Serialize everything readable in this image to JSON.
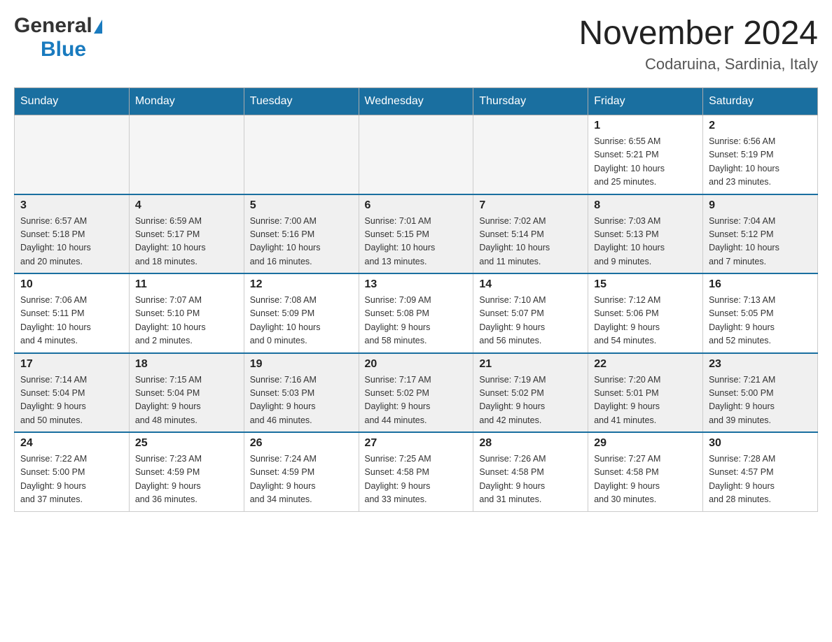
{
  "logo": {
    "text1": "General",
    "text2": "Blue"
  },
  "title": "November 2024",
  "location": "Codaruina, Sardinia, Italy",
  "days_of_week": [
    "Sunday",
    "Monday",
    "Tuesday",
    "Wednesday",
    "Thursday",
    "Friday",
    "Saturday"
  ],
  "weeks": [
    [
      {
        "day": "",
        "info": ""
      },
      {
        "day": "",
        "info": ""
      },
      {
        "day": "",
        "info": ""
      },
      {
        "day": "",
        "info": ""
      },
      {
        "day": "",
        "info": ""
      },
      {
        "day": "1",
        "info": "Sunrise: 6:55 AM\nSunset: 5:21 PM\nDaylight: 10 hours\nand 25 minutes."
      },
      {
        "day": "2",
        "info": "Sunrise: 6:56 AM\nSunset: 5:19 PM\nDaylight: 10 hours\nand 23 minutes."
      }
    ],
    [
      {
        "day": "3",
        "info": "Sunrise: 6:57 AM\nSunset: 5:18 PM\nDaylight: 10 hours\nand 20 minutes."
      },
      {
        "day": "4",
        "info": "Sunrise: 6:59 AM\nSunset: 5:17 PM\nDaylight: 10 hours\nand 18 minutes."
      },
      {
        "day": "5",
        "info": "Sunrise: 7:00 AM\nSunset: 5:16 PM\nDaylight: 10 hours\nand 16 minutes."
      },
      {
        "day": "6",
        "info": "Sunrise: 7:01 AM\nSunset: 5:15 PM\nDaylight: 10 hours\nand 13 minutes."
      },
      {
        "day": "7",
        "info": "Sunrise: 7:02 AM\nSunset: 5:14 PM\nDaylight: 10 hours\nand 11 minutes."
      },
      {
        "day": "8",
        "info": "Sunrise: 7:03 AM\nSunset: 5:13 PM\nDaylight: 10 hours\nand 9 minutes."
      },
      {
        "day": "9",
        "info": "Sunrise: 7:04 AM\nSunset: 5:12 PM\nDaylight: 10 hours\nand 7 minutes."
      }
    ],
    [
      {
        "day": "10",
        "info": "Sunrise: 7:06 AM\nSunset: 5:11 PM\nDaylight: 10 hours\nand 4 minutes."
      },
      {
        "day": "11",
        "info": "Sunrise: 7:07 AM\nSunset: 5:10 PM\nDaylight: 10 hours\nand 2 minutes."
      },
      {
        "day": "12",
        "info": "Sunrise: 7:08 AM\nSunset: 5:09 PM\nDaylight: 10 hours\nand 0 minutes."
      },
      {
        "day": "13",
        "info": "Sunrise: 7:09 AM\nSunset: 5:08 PM\nDaylight: 9 hours\nand 58 minutes."
      },
      {
        "day": "14",
        "info": "Sunrise: 7:10 AM\nSunset: 5:07 PM\nDaylight: 9 hours\nand 56 minutes."
      },
      {
        "day": "15",
        "info": "Sunrise: 7:12 AM\nSunset: 5:06 PM\nDaylight: 9 hours\nand 54 minutes."
      },
      {
        "day": "16",
        "info": "Sunrise: 7:13 AM\nSunset: 5:05 PM\nDaylight: 9 hours\nand 52 minutes."
      }
    ],
    [
      {
        "day": "17",
        "info": "Sunrise: 7:14 AM\nSunset: 5:04 PM\nDaylight: 9 hours\nand 50 minutes."
      },
      {
        "day": "18",
        "info": "Sunrise: 7:15 AM\nSunset: 5:04 PM\nDaylight: 9 hours\nand 48 minutes."
      },
      {
        "day": "19",
        "info": "Sunrise: 7:16 AM\nSunset: 5:03 PM\nDaylight: 9 hours\nand 46 minutes."
      },
      {
        "day": "20",
        "info": "Sunrise: 7:17 AM\nSunset: 5:02 PM\nDaylight: 9 hours\nand 44 minutes."
      },
      {
        "day": "21",
        "info": "Sunrise: 7:19 AM\nSunset: 5:02 PM\nDaylight: 9 hours\nand 42 minutes."
      },
      {
        "day": "22",
        "info": "Sunrise: 7:20 AM\nSunset: 5:01 PM\nDaylight: 9 hours\nand 41 minutes."
      },
      {
        "day": "23",
        "info": "Sunrise: 7:21 AM\nSunset: 5:00 PM\nDaylight: 9 hours\nand 39 minutes."
      }
    ],
    [
      {
        "day": "24",
        "info": "Sunrise: 7:22 AM\nSunset: 5:00 PM\nDaylight: 9 hours\nand 37 minutes."
      },
      {
        "day": "25",
        "info": "Sunrise: 7:23 AM\nSunset: 4:59 PM\nDaylight: 9 hours\nand 36 minutes."
      },
      {
        "day": "26",
        "info": "Sunrise: 7:24 AM\nSunset: 4:59 PM\nDaylight: 9 hours\nand 34 minutes."
      },
      {
        "day": "27",
        "info": "Sunrise: 7:25 AM\nSunset: 4:58 PM\nDaylight: 9 hours\nand 33 minutes."
      },
      {
        "day": "28",
        "info": "Sunrise: 7:26 AM\nSunset: 4:58 PM\nDaylight: 9 hours\nand 31 minutes."
      },
      {
        "day": "29",
        "info": "Sunrise: 7:27 AM\nSunset: 4:58 PM\nDaylight: 9 hours\nand 30 minutes."
      },
      {
        "day": "30",
        "info": "Sunrise: 7:28 AM\nSunset: 4:57 PM\nDaylight: 9 hours\nand 28 minutes."
      }
    ]
  ]
}
